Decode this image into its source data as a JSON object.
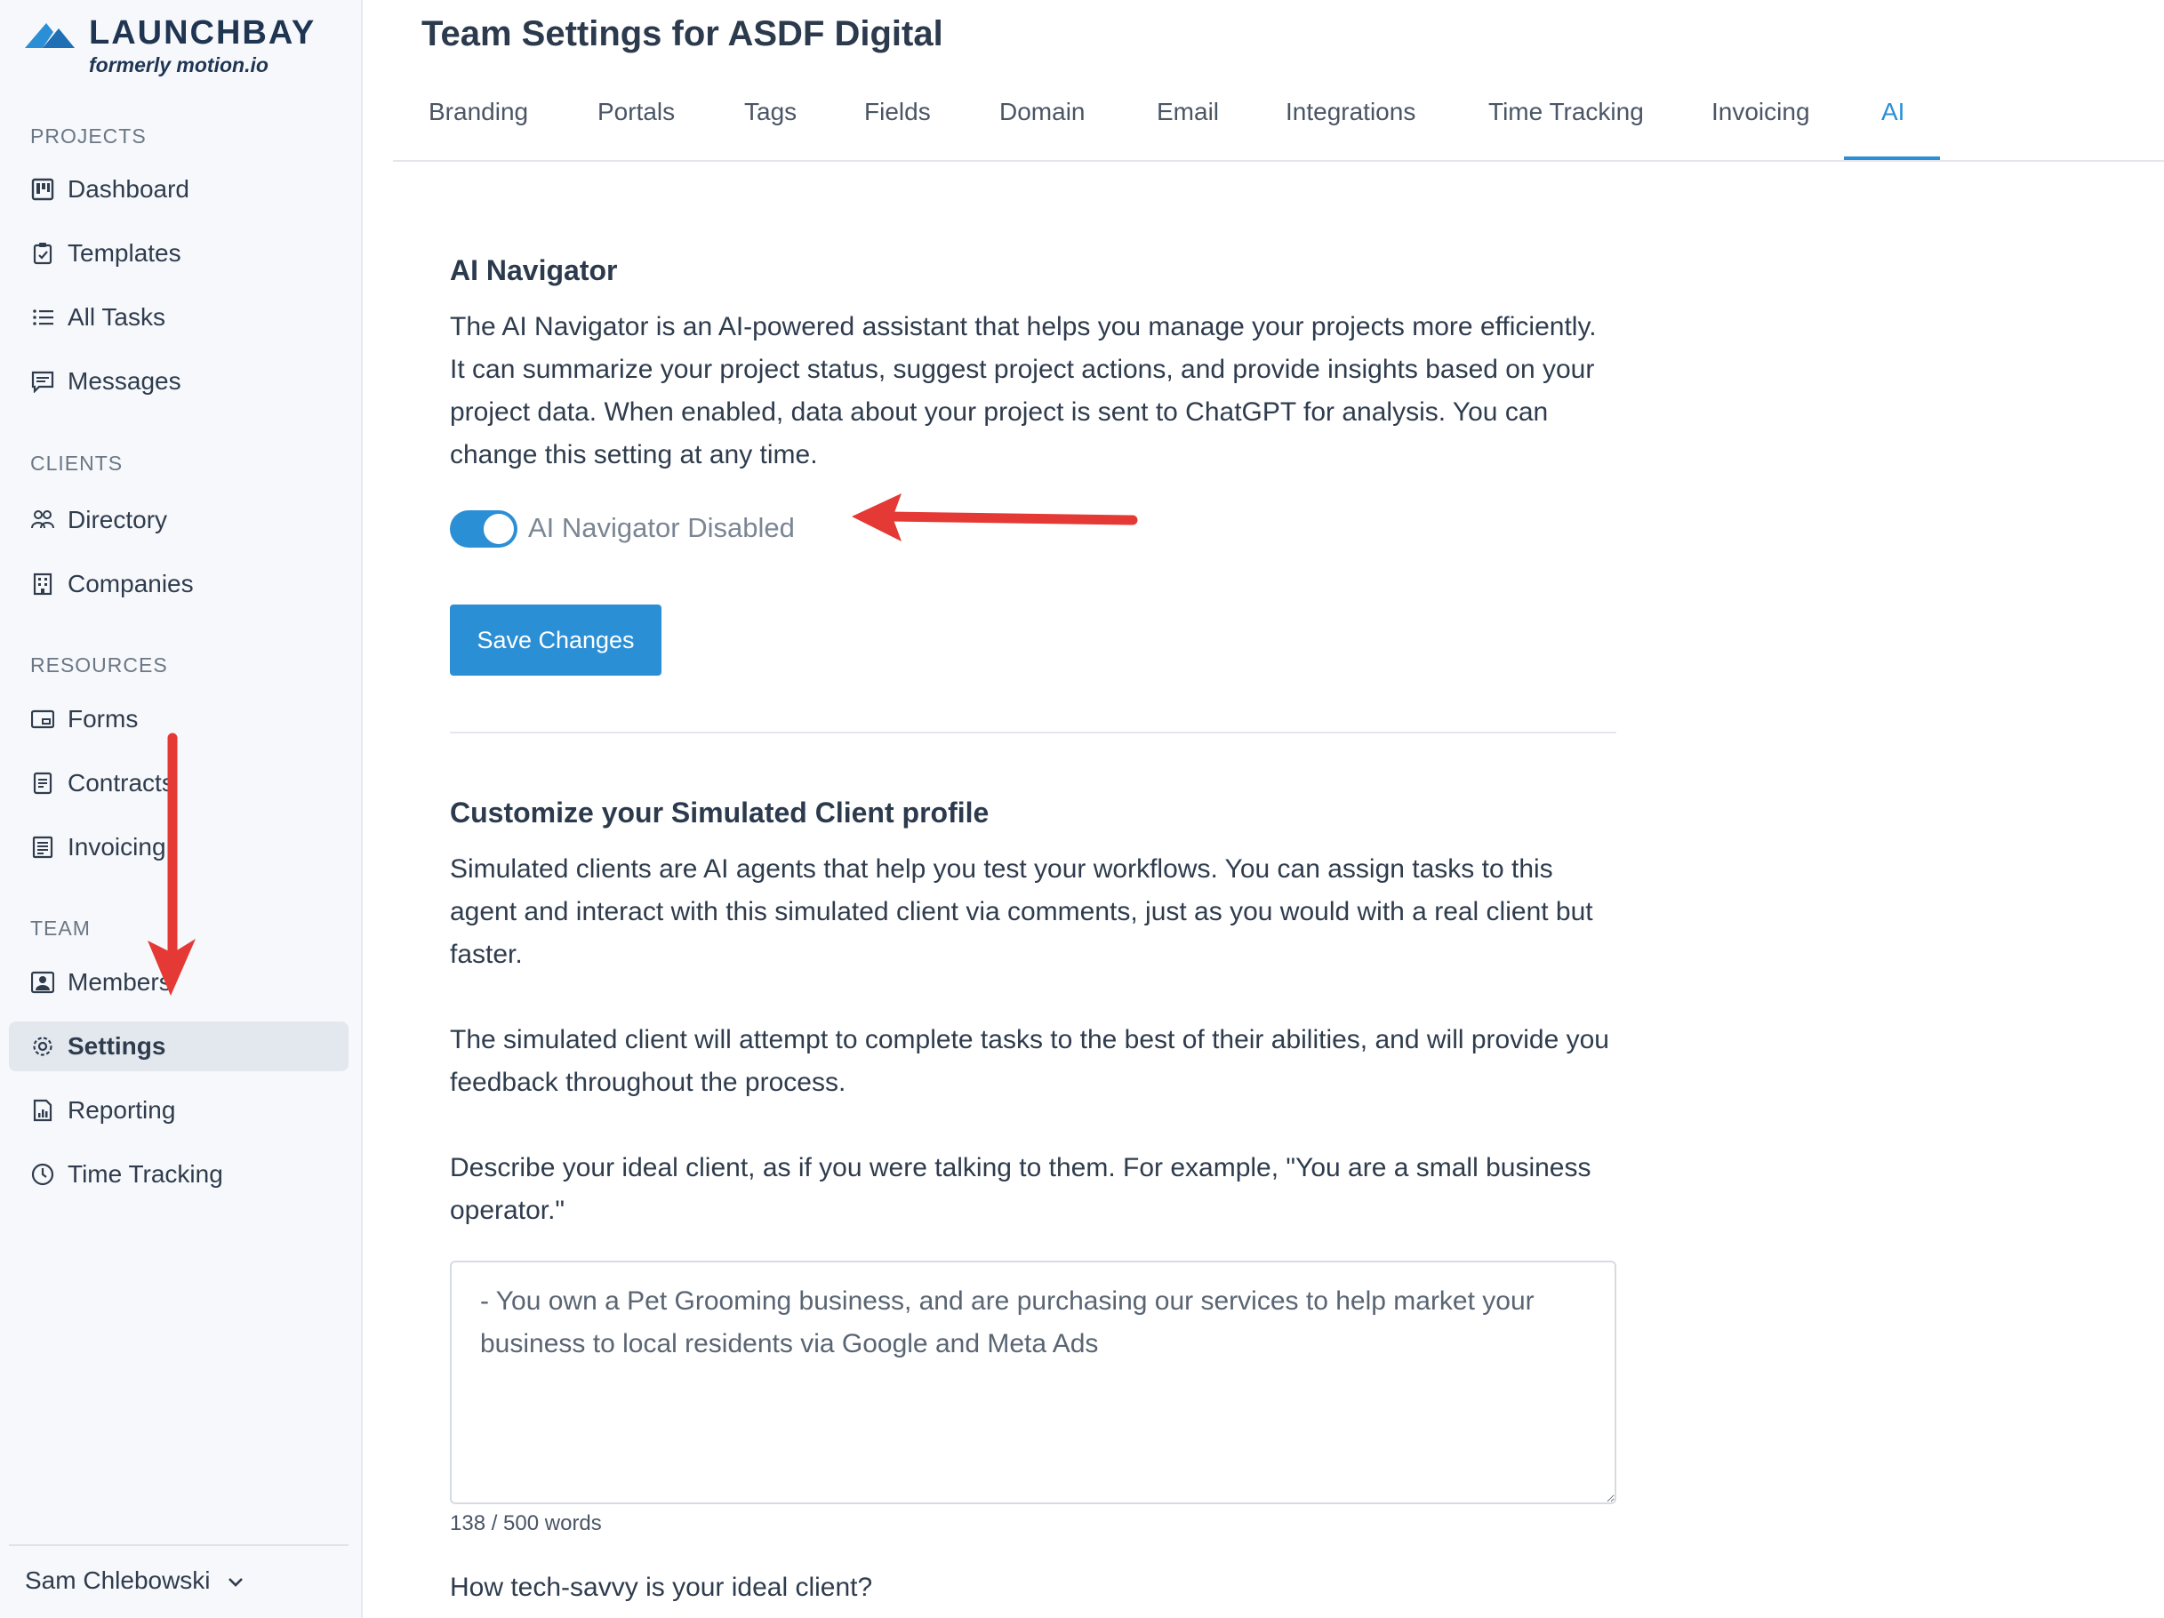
{
  "brand": {
    "name": "LAUNCHBAY",
    "subtitle": "formerly motion.io"
  },
  "sidebar": {
    "sections": [
      {
        "label": "PROJECTS",
        "items": [
          {
            "label": "Dashboard",
            "icon": "kanban-icon"
          },
          {
            "label": "Templates",
            "icon": "clipboard-check-icon"
          },
          {
            "label": "All Tasks",
            "icon": "list-icon"
          },
          {
            "label": "Messages",
            "icon": "message-icon"
          }
        ]
      },
      {
        "label": "CLIENTS",
        "items": [
          {
            "label": "Directory",
            "icon": "users-icon"
          },
          {
            "label": "Companies",
            "icon": "building-icon"
          }
        ]
      },
      {
        "label": "RESOURCES",
        "items": [
          {
            "label": "Forms",
            "icon": "form-icon"
          },
          {
            "label": "Contracts",
            "icon": "document-icon"
          },
          {
            "label": "Invoicing",
            "icon": "invoice-icon"
          }
        ]
      },
      {
        "label": "TEAM",
        "items": [
          {
            "label": "Members",
            "icon": "member-icon"
          },
          {
            "label": "Settings",
            "icon": "gear-icon",
            "active": true
          },
          {
            "label": "Reporting",
            "icon": "report-icon"
          },
          {
            "label": "Time Tracking",
            "icon": "clock-icon"
          }
        ]
      }
    ],
    "user": {
      "name": "Sam Chlebowski"
    }
  },
  "page": {
    "title": "Team Settings for ASDF Digital",
    "tabs": [
      {
        "label": "Branding"
      },
      {
        "label": "Portals"
      },
      {
        "label": "Tags"
      },
      {
        "label": "Fields"
      },
      {
        "label": "Domain"
      },
      {
        "label": "Email"
      },
      {
        "label": "Integrations"
      },
      {
        "label": "Time Tracking"
      },
      {
        "label": "Invoicing"
      },
      {
        "label": "AI",
        "active": true
      }
    ]
  },
  "ai_navigator": {
    "title": "AI Navigator",
    "description": "The AI Navigator is an AI-powered assistant that helps you manage your projects more efficiently. It can summarize your project status, suggest project actions, and provide insights based on your project data. When enabled, data about your project is sent to ChatGPT for analysis. You can change this setting at any time.",
    "toggle_label": "AI Navigator Disabled",
    "toggle_on": true,
    "save_label": "Save Changes"
  },
  "simulated_client": {
    "title": "Customize your Simulated Client profile",
    "para1": "Simulated clients are AI agents that help you test your workflows. You can assign tasks to this agent and interact with this simulated client via comments, just as you would with a real client but faster.",
    "para2": "The simulated client will attempt to complete tasks to the best of their abilities, and will provide you feedback throughout the process.",
    "para3": "Describe your ideal client, as if you were talking to them. For example, \"You are a small business operator.\"",
    "profile_value": "- You own a Pet Grooming business, and are purchasing our services to help market your business to local residents via Google and Meta Ads",
    "word_count": "138 / 500 words",
    "question": "How tech-savvy is your ideal client?"
  },
  "colors": {
    "accent": "#2b8fd6",
    "annotation_arrow": "#e53935",
    "sidebar_bg": "#f6f8fb"
  }
}
